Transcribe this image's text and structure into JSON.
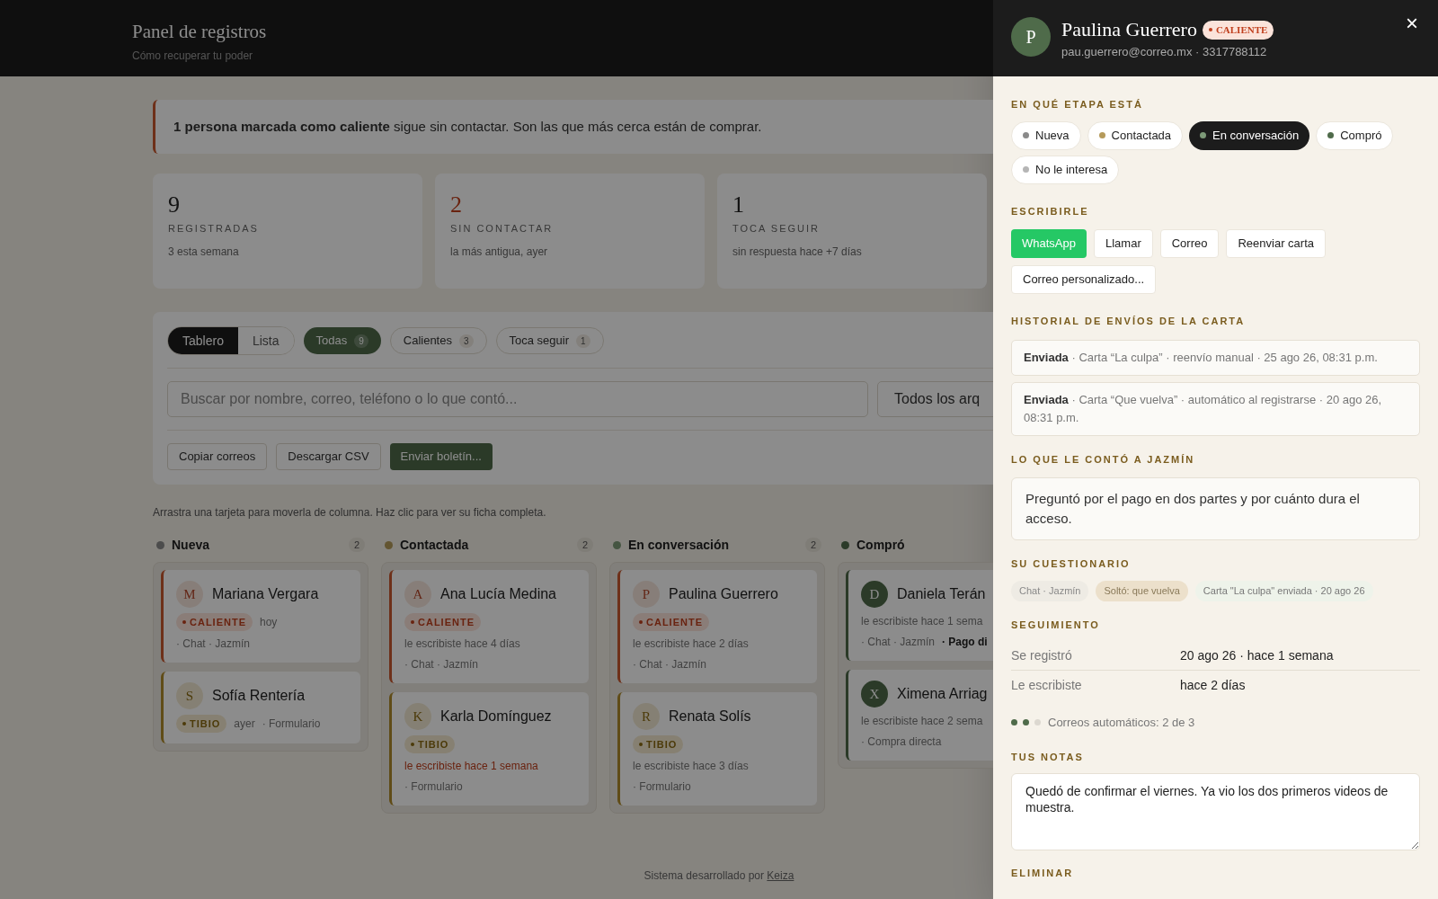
{
  "header": {
    "title": "Panel de registros",
    "subtitle": "Cómo recuperar tu poder"
  },
  "alert": {
    "text": "**1 persona marcada como caliente** sigue sin contactar. Son las que más cerca están de comprar."
  },
  "stats": [
    {
      "value": "9",
      "label": "REGISTRADAS",
      "note": "3 esta semana",
      "alert": false
    },
    {
      "value": "2",
      "label": "SIN CONTACTAR",
      "note": "la más antigua, ayer",
      "alert": true
    },
    {
      "value": "1",
      "label": "TOCA SEGUIR",
      "note": "sin respuesta hace +7 días",
      "alert": false
    }
  ],
  "view_tabs": [
    {
      "label": "Tablero",
      "selected": true
    },
    {
      "label": "Lista",
      "selected": false
    }
  ],
  "filters": [
    {
      "label": "Todas",
      "count": "9",
      "selected": true
    },
    {
      "label": "Calientes",
      "count": "3",
      "selected": false
    },
    {
      "label": "Toca seguir",
      "count": "1",
      "selected": false
    }
  ],
  "search": {
    "placeholder": "Buscar por nombre, correo, teléfono o lo que contó..."
  },
  "type_select": {
    "value": "Todos los arq"
  },
  "actions": [
    {
      "label": "Copiar correos",
      "kind": "plain"
    },
    {
      "label": "Descargar CSV",
      "kind": "plain"
    },
    {
      "label": "Enviar boletín...",
      "kind": "primary"
    }
  ],
  "hint": "Arrastra una tarjeta para moverla de columna. Haz clic para ver su ficha completa.",
  "columns": [
    {
      "name": "Nueva",
      "count": "2",
      "color": "#4c4c4c",
      "cards": [
        {
          "initial": "M",
          "name": "Mariana Vergara",
          "kind": "hot",
          "rows": [
            [
              {
                "kind": "badge-hot",
                "text": "CALIENTE"
              },
              {
                "kind": "muted",
                "text": "hoy"
              }
            ],
            [
              {
                "kind": "muted",
                "text": "· Chat · Jazmín"
              }
            ]
          ]
        },
        {
          "initial": "S",
          "name": "Sofía Rentería",
          "kind": "warm",
          "rows": [
            [
              {
                "kind": "badge-warm",
                "text": "TIBIO"
              },
              {
                "kind": "muted",
                "text": "ayer"
              },
              {
                "kind": "muted",
                "text": "· Formulario"
              }
            ]
          ]
        }
      ]
    },
    {
      "name": "Contactada",
      "count": "2",
      "color": "#635531",
      "cards": [
        {
          "initial": "A",
          "name": "Ana Lucía Medina",
          "kind": "hot",
          "rows": [
            [
              {
                "kind": "badge-hot",
                "text": "CALIENTE"
              }
            ],
            [
              {
                "kind": "muted",
                "text": "le escribiste hace 4 días"
              }
            ],
            [
              {
                "kind": "muted",
                "text": "· Chat · Jazmín"
              }
            ]
          ]
        },
        {
          "initial": "K",
          "name": "Karla Domínguez",
          "kind": "warm",
          "rows": [
            [
              {
                "kind": "badge-warm",
                "text": "TIBIO"
              }
            ],
            [
              {
                "kind": "overdue",
                "text": "le escribiste hace 1 semana"
              }
            ],
            [
              {
                "kind": "muted",
                "text": "· Formulario"
              }
            ]
          ]
        }
      ]
    },
    {
      "name": "En conversación",
      "count": "2",
      "color": "#455542",
      "cards": [
        {
          "initial": "P",
          "name": "Paulina Guerrero",
          "kind": "hot",
          "rows": [
            [
              {
                "kind": "badge-hot",
                "text": "CALIENTE"
              }
            ],
            [
              {
                "kind": "muted",
                "text": "le escribiste hace 2 días"
              }
            ],
            [
              {
                "kind": "muted",
                "text": "· Chat · Jazmín"
              }
            ]
          ]
        },
        {
          "initial": "R",
          "name": "Renata Solís",
          "kind": "warm",
          "rows": [
            [
              {
                "kind": "badge-warm",
                "text": "TIBIO"
              }
            ],
            [
              {
                "kind": "muted",
                "text": "le escribiste hace 3 días"
              }
            ],
            [
              {
                "kind": "muted",
                "text": "· Formulario"
              }
            ]
          ]
        }
      ]
    },
    {
      "name": "Compró",
      "color": "#2b3b29",
      "cards": [
        {
          "initial": "D",
          "name": "Daniela Terán",
          "kind": "bought",
          "rows": [
            [
              {
                "kind": "muted",
                "text": "le escribiste hace 1 sema"
              }
            ],
            [
              {
                "kind": "muted",
                "text": "· Chat · Jazmín"
              },
              {
                "kind": "strong",
                "text": "· Pago di"
              }
            ]
          ]
        },
        {
          "initial": "X",
          "name": "Ximena Arriag",
          "kind": "bought",
          "rows": [
            [
              {
                "kind": "muted",
                "text": "le escribiste hace 2 sema"
              }
            ],
            [
              {
                "kind": "muted",
                "text": "· Compra directa"
              }
            ]
          ]
        }
      ]
    }
  ],
  "footer": {
    "text": "Sistema desarrollado por",
    "link": "Keiza"
  },
  "drawer": {
    "initial": "P",
    "name": "Paulina Guerrero",
    "badge": {
      "text": "CALIENTE",
      "kind": "hot"
    },
    "contact": "pau.guerrero@correo.mx · 3317788112",
    "close": "×",
    "stage_title": "EN QUÉ ETAPA ESTÁ",
    "stages": [
      {
        "label": "Nueva",
        "color": "#8a8a8a",
        "selected": false
      },
      {
        "label": "Contactada",
        "color": "#b59a5a",
        "selected": false
      },
      {
        "label": "En conversación",
        "color": "#7d9a78",
        "selected": true
      },
      {
        "label": "Compró",
        "color": "#4f6b4a",
        "selected": false
      },
      {
        "label": "No le interesa",
        "color": "#b5b5b5",
        "selected": false
      }
    ],
    "write_title": "ESCRIBIRLE",
    "write_actions": [
      {
        "label": "WhatsApp",
        "kind": "whatsapp"
      },
      {
        "label": "Llamar",
        "kind": "plain"
      },
      {
        "label": "Correo",
        "kind": "plain"
      },
      {
        "label": "Reenviar carta",
        "kind": "plain"
      },
      {
        "label": "Correo personalizado...",
        "kind": "plain"
      }
    ],
    "history_title": "HISTORIAL DE ENVÍOS DE LA CARTA",
    "history": [
      "**Enviada** · Carta “La culpa” · reenvío manual · 25 ago 26, 08:31 p.m.",
      "**Enviada** · Carta “Que vuelva” · automático al registrarse · 20 ago 26, 08:31 p.m."
    ],
    "story_title": "LO QUE LE CONTÓ A JAZMÍN",
    "story": "Preguntó por el pago en dos partes y por cuánto dura el acceso.",
    "quiz_title": "SU CUESTIONARIO",
    "quiz_tags": [
      {
        "text": "Chat · Jazmín",
        "kind": "neutral"
      },
      {
        "text": "Soltó: que vuelva",
        "kind": "warm"
      },
      {
        "text": "Carta \"La culpa\" enviada · 20 ago 26",
        "kind": "sent"
      }
    ],
    "follow_title": "SEGUIMIENTO",
    "follow": [
      {
        "label": "Se registró",
        "value": "20 ago 26 · hace 1 semana"
      },
      {
        "label": "Le escribiste",
        "value": "hace 2 días"
      }
    ],
    "auto_emails": {
      "dots": [
        {
          "filled": true
        },
        {
          "filled": true
        },
        {
          "filled": false
        }
      ],
      "text": "Correos automáticos: 2 de 3"
    },
    "notes_title": "TUS NOTAS",
    "notes": "Quedó de confirmar el viernes. Ya vio los dos primeros videos de muestra.",
    "delete_title": "ELIMINAR"
  }
}
